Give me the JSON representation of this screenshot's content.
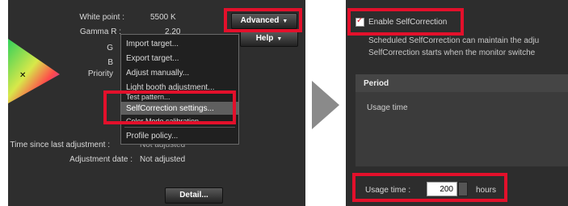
{
  "left": {
    "fields": {
      "white_point_label": "White point :",
      "white_point_value": "5500 K",
      "gamma_r_label": "Gamma R :",
      "gamma_r_value": "2.20",
      "g_label": "G",
      "b_label": "B",
      "priority_label": "Priority",
      "time_since_label": "Time since last adjustment :",
      "time_since_value": "Not adjusted",
      "adjustment_date_label": "Adjustment date :",
      "adjustment_date_value": "Not adjusted"
    },
    "buttons": {
      "advanced": "Advanced",
      "help": "Help",
      "detail": "Detail..."
    },
    "menu": {
      "items": [
        "Import target...",
        "Export target...",
        "Adjust manually...",
        "Light booth adjustment...",
        "Test pattern...",
        "SelfCorrection settings...",
        "Color Mode calibration...",
        "Profile policy..."
      ]
    }
  },
  "right": {
    "enable_label": "Enable SelfCorrection",
    "enable_checked": true,
    "desc_line1": "Scheduled SelfCorrection can maintain the adju",
    "desc_line2": "SelfCorrection starts when the monitor switche",
    "period_title": "Period",
    "usage_time_option": "Usage time",
    "usage_time_label": "Usage time :",
    "usage_time_value": "200",
    "hours_label": "hours"
  },
  "colors": {
    "highlight": "#e3102b",
    "panel_bg": "#2e2e2e",
    "menu_selected": "#5f5f5f"
  }
}
